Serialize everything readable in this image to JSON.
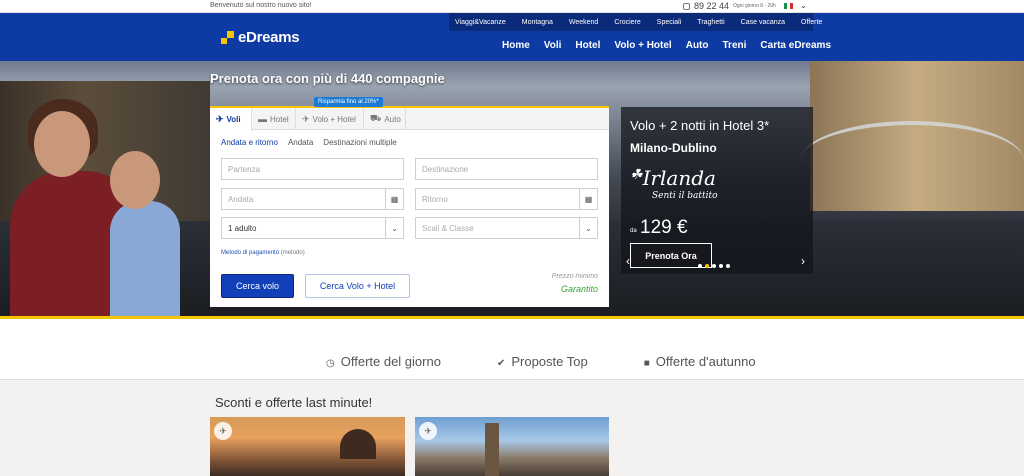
{
  "topbar": {
    "welcome": "Benvenuto sul nostro nuovo sito!",
    "phone": "89 22 44",
    "hours": "Ogni giorno 8 - 20h"
  },
  "brand": {
    "name": "eDreams",
    "accent": "#f6c400",
    "primary": "#0d3aa3"
  },
  "subnav": [
    "Viaggi&Vacanze",
    "Montagna",
    "Weekend",
    "Crociere",
    "Speciali",
    "Traghetti",
    "Case vacanza",
    "Offerte"
  ],
  "mainnav": [
    "Home",
    "Voli",
    "Hotel",
    "Volo + Hotel",
    "Auto",
    "Treni",
    "Carta eDreams"
  ],
  "hero": {
    "tagline": "Prenota ora con più di 440 compagnie"
  },
  "search": {
    "tabs": [
      "Voli",
      "Hotel",
      "Volo + Hotel",
      "Auto"
    ],
    "promo_badge": "Risparmia fino al 20%*",
    "trip_types": [
      "Andata e ritorno",
      "Andata",
      "Destinazioni multiple"
    ],
    "departure_placeholder": "Partenza",
    "destination_placeholder": "Destinazione",
    "outbound_placeholder": "Andata",
    "return_placeholder": "Ritorno",
    "passengers": "1 adulto",
    "class_placeholder": "Scali & Classe",
    "payment_link": "Metodo di pagamento",
    "payment_sub": "(metodo)",
    "search_flight": "Cerca volo",
    "search_flight_hotel": "Cerca Volo + Hotel",
    "min_price_label": "Prezzo minimo",
    "min_price_value": "Garantito"
  },
  "promo": {
    "title": "Volo + 2 notti in Hotel 3*",
    "route": "Milano-Dublino",
    "brand": "Irlanda",
    "slogan": "Senti il battito",
    "from": "da",
    "price": "129 €",
    "cta": "Prenota Ora"
  },
  "offers": {
    "tabs": [
      "Offerte del giorno",
      "Proposte Top",
      "Offerte d'autunno"
    ],
    "section_title": "Sconti e offerte last minute!"
  }
}
